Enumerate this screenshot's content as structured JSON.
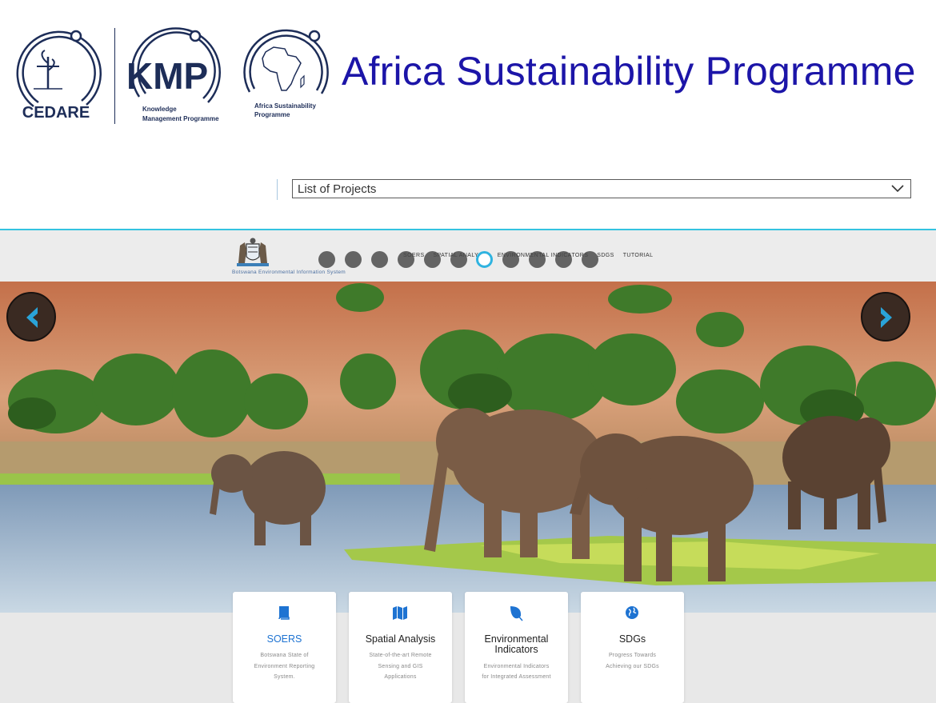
{
  "header": {
    "title": "Africa Sustainability Programme",
    "logos": {
      "cedare": "CEDARE",
      "kmp": "KMP",
      "kmp_sub1": "Knowledge",
      "kmp_sub2": "Management Programme",
      "asp_sub1": "Africa Sustainability",
      "asp_sub2": "Programme"
    }
  },
  "project_select": {
    "label": "List of Projects"
  },
  "embedded_site": {
    "caption": "Botswana Environmental Information System",
    "nav": [
      "SOERS",
      "SPATIAL ANALYSIS",
      "ENVIRONMENTAL INDICATORS",
      "SDGS",
      "TUTORIAL"
    ],
    "slider_dots": {
      "count": 11,
      "active_index": 6
    }
  },
  "cards": [
    {
      "title": "SOERS",
      "desc": [
        "Botswana State of",
        "Environment Reporting",
        "System."
      ],
      "icon": "book-icon"
    },
    {
      "title": "Spatial Analysis",
      "desc": [
        "State-of-the-art Remote",
        "Sensing and GIS",
        "Applications"
      ],
      "icon": "map-icon"
    },
    {
      "title": "Environmental Indicators",
      "desc": [
        "Environmental Indicators",
        "for Integrated Assessment"
      ],
      "icon": "leaf-icon"
    },
    {
      "title": "SDGs",
      "desc": [
        "Progress Towards",
        "Achieving our SDGs"
      ],
      "icon": "globe-icon"
    }
  ],
  "colors": {
    "title_blue": "#1c15a8",
    "accent_cyan": "#33c3e0",
    "link_blue": "#1e73d2",
    "arrow_blue": "#2aa3d8"
  }
}
